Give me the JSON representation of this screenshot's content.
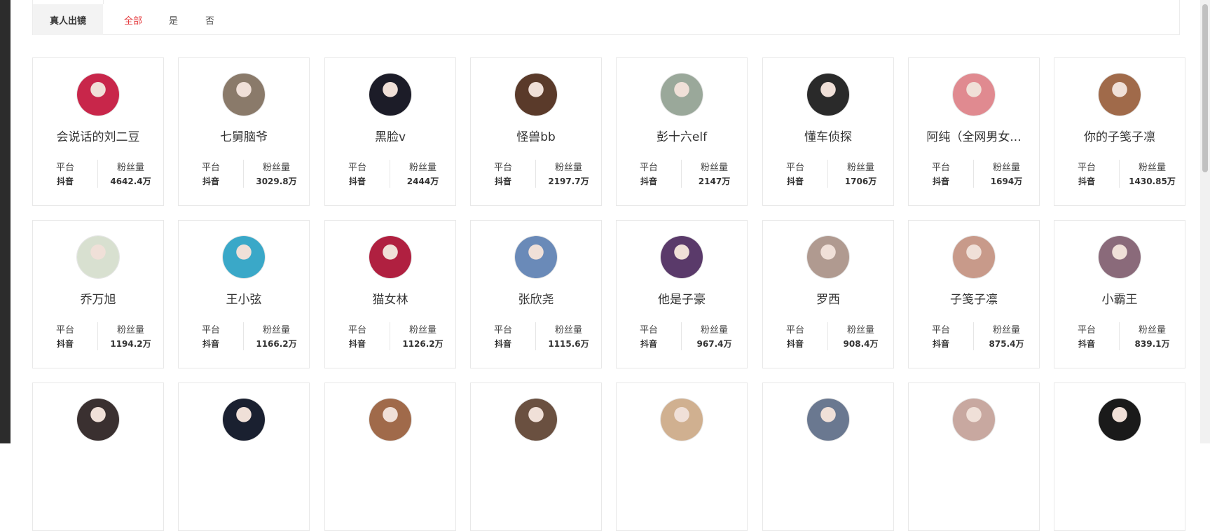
{
  "filter": {
    "label": "真人出镜",
    "options": [
      "全部",
      "是",
      "否"
    ],
    "active": "全部"
  },
  "card_labels": {
    "platform": "平台",
    "fans": "粉丝量"
  },
  "cards": [
    {
      "name": "会说话的刘二豆",
      "platform": "抖音",
      "fans": "4642.4万",
      "avatar_color": "#c8264a"
    },
    {
      "name": "七舅脑爷",
      "platform": "抖音",
      "fans": "3029.8万",
      "avatar_color": "#8a7a6a"
    },
    {
      "name": "黑脸v",
      "platform": "抖音",
      "fans": "2444万",
      "avatar_color": "#1c1c28"
    },
    {
      "name": "怪兽bb",
      "platform": "抖音",
      "fans": "2197.7万",
      "avatar_color": "#5a3a2a"
    },
    {
      "name": "彭十六elf",
      "platform": "抖音",
      "fans": "2147万",
      "avatar_color": "#9aa89a"
    },
    {
      "name": "懂车侦探",
      "platform": "抖音",
      "fans": "1706万",
      "avatar_color": "#2a2a2a"
    },
    {
      "name": "阿纯（全网男女...",
      "platform": "抖音",
      "fans": "1694万",
      "avatar_color": "#e08a90"
    },
    {
      "name": "你的子笺子凛",
      "platform": "抖音",
      "fans": "1430.85万",
      "avatar_color": "#a06a4a"
    },
    {
      "name": "乔万旭",
      "platform": "抖音",
      "fans": "1194.2万",
      "avatar_color": "#d8e0d0"
    },
    {
      "name": "王小弦",
      "platform": "抖音",
      "fans": "1166.2万",
      "avatar_color": "#3aa8c8"
    },
    {
      "name": "猫女林",
      "platform": "抖音",
      "fans": "1126.2万",
      "avatar_color": "#b02040"
    },
    {
      "name": "张欣尧",
      "platform": "抖音",
      "fans": "1115.6万",
      "avatar_color": "#6a8ab8"
    },
    {
      "name": "他是子豪",
      "platform": "抖音",
      "fans": "967.4万",
      "avatar_color": "#5a3a6a"
    },
    {
      "name": "罗西",
      "platform": "抖音",
      "fans": "908.4万",
      "avatar_color": "#b09a90"
    },
    {
      "name": "子笺子凛",
      "platform": "抖音",
      "fans": "875.4万",
      "avatar_color": "#c89a8a"
    },
    {
      "name": "小霸王",
      "platform": "抖音",
      "fans": "839.1万",
      "avatar_color": "#8a6a7a"
    },
    {
      "name": "",
      "platform": "",
      "fans": "",
      "avatar_color": "#3a3030"
    },
    {
      "name": "",
      "platform": "",
      "fans": "",
      "avatar_color": "#1a2030"
    },
    {
      "name": "",
      "platform": "",
      "fans": "",
      "avatar_color": "#a06a4a"
    },
    {
      "name": "",
      "platform": "",
      "fans": "",
      "avatar_color": "#6a5040"
    },
    {
      "name": "",
      "platform": "",
      "fans": "",
      "avatar_color": "#d0b090"
    },
    {
      "name": "",
      "platform": "",
      "fans": "",
      "avatar_color": "#6a7890"
    },
    {
      "name": "",
      "platform": "",
      "fans": "",
      "avatar_color": "#c8a8a0"
    },
    {
      "name": "",
      "platform": "",
      "fans": "",
      "avatar_color": "#1a1a1a"
    }
  ]
}
